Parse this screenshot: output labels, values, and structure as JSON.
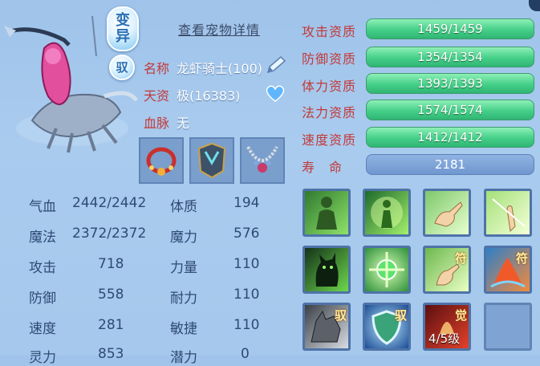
{
  "header": {
    "variant_badge": "变异",
    "tame_badge": "驭",
    "detail_link": "查看宠物详情"
  },
  "info": {
    "name_label": "名称",
    "name_value": "龙虾骑士(100)",
    "talent_label": "天资",
    "talent_value": "极(16383)",
    "bloodline_label": "血脉",
    "bloodline_value": "无"
  },
  "equipment": [
    {
      "name": "red-bead-bracelet"
    },
    {
      "name": "dark-armor"
    },
    {
      "name": "bead-necklace"
    }
  ],
  "stats": [
    {
      "label": "气血",
      "value": "2442/2442",
      "label2": "体质",
      "value2": "194"
    },
    {
      "label": "魔法",
      "value": "2372/2372",
      "label2": "魔力",
      "value2": "576"
    },
    {
      "label": "攻击",
      "value": "718",
      "label2": "力量",
      "value2": "110"
    },
    {
      "label": "防御",
      "value": "558",
      "label2": "耐力",
      "value2": "110"
    },
    {
      "label": "速度",
      "value": "281",
      "label2": "敏捷",
      "value2": "110"
    },
    {
      "label": "灵力",
      "value": "853",
      "label2": "潜力",
      "value2": "0"
    }
  ],
  "aptitudes": [
    {
      "label": "攻击资质",
      "value": "1459/1459"
    },
    {
      "label": "防御资质",
      "value": "1354/1354"
    },
    {
      "label": "体力资质",
      "value": "1393/1393"
    },
    {
      "label": "法力资质",
      "value": "1574/1574"
    },
    {
      "label": "速度资质",
      "value": "1412/1412"
    }
  ],
  "lifespan": {
    "label": "寿　命",
    "value": "2181"
  },
  "skills": [
    {
      "icon": "green-figure-icon",
      "tag": "",
      "level": ""
    },
    {
      "icon": "glowing-figure-icon",
      "tag": "",
      "level": ""
    },
    {
      "icon": "pointing-hand-icon",
      "tag": "",
      "level": ""
    },
    {
      "icon": "light-hand-icon",
      "tag": "",
      "level": ""
    },
    {
      "icon": "green-cat-icon",
      "tag": "",
      "level": ""
    },
    {
      "icon": "green-orb-icon",
      "tag": "",
      "level": ""
    },
    {
      "icon": "talisman-hand-icon",
      "tag": "符",
      "level": ""
    },
    {
      "icon": "talisman-flame-icon",
      "tag": "符",
      "level": ""
    },
    {
      "icon": "wolf-icon",
      "tag": "驭",
      "level": ""
    },
    {
      "icon": "shield-icon",
      "tag": "驭",
      "level": ""
    },
    {
      "icon": "awaken-icon",
      "tag": "觉",
      "level": "4/5级"
    },
    {
      "icon": "empty-slot",
      "tag": "",
      "level": ""
    }
  ],
  "colors": {
    "label_red": "#c33a3a",
    "bar_green": "#45cf88",
    "panel_blue": "#a9cbee"
  }
}
